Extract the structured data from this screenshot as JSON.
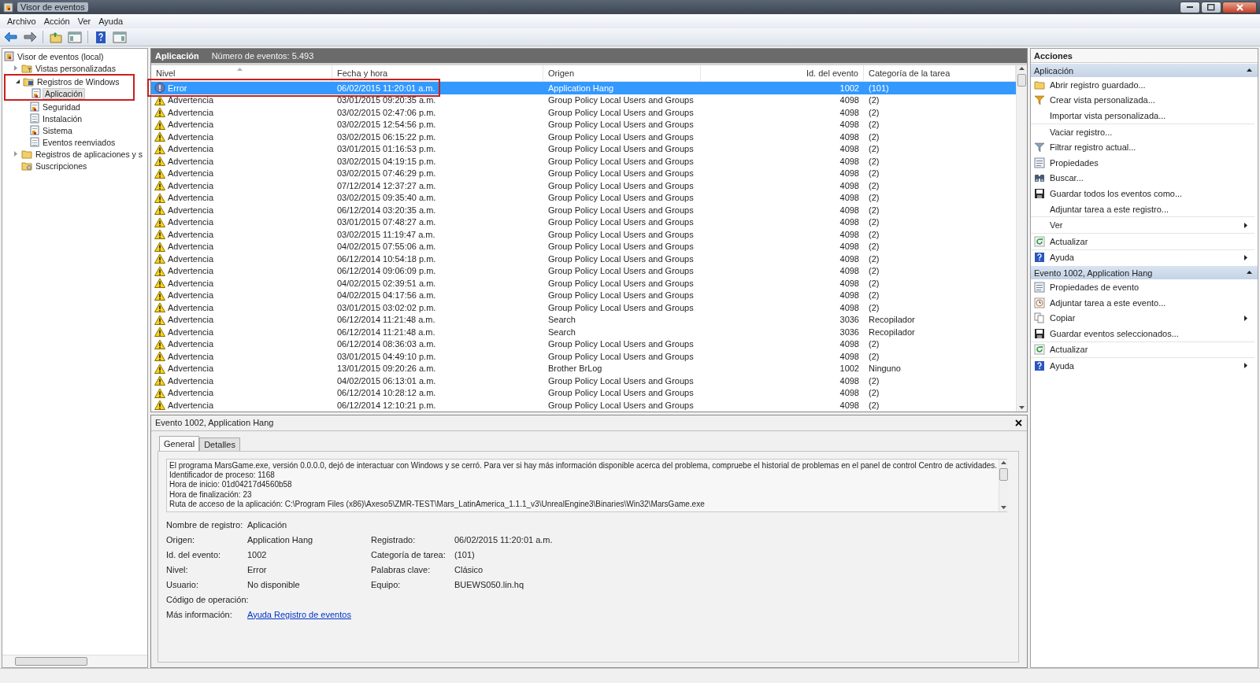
{
  "window": {
    "title": "Visor de eventos"
  },
  "menu": [
    "Archivo",
    "Acción",
    "Ver",
    "Ayuda"
  ],
  "tree": [
    {
      "label": "Visor de eventos (local)",
      "kind": "viewer",
      "selected": false,
      "children": [
        {
          "label": "Vistas personalizadas",
          "kind": "folder-filter",
          "selected": false,
          "expandable": true,
          "expanded": false
        },
        {
          "label": "Registros de Windows",
          "kind": "folder-windows",
          "selected": false,
          "expandable": true,
          "expanded": true,
          "marked": true,
          "children": [
            {
              "label": "Aplicación",
              "kind": "log",
              "selected": true,
              "marked": true
            },
            {
              "label": "Seguridad",
              "kind": "log",
              "selected": false
            },
            {
              "label": "Instalación",
              "kind": "log-plain",
              "selected": false
            },
            {
              "label": "Sistema",
              "kind": "log",
              "selected": false
            },
            {
              "label": "Eventos reenviados",
              "kind": "log-plain",
              "selected": false
            }
          ]
        },
        {
          "label": "Registros de aplicaciones y s",
          "kind": "folder",
          "selected": false,
          "expandable": true,
          "expanded": false
        },
        {
          "label": "Suscripciones",
          "kind": "folder-subs",
          "selected": false
        }
      ]
    }
  ],
  "list_header": {
    "title": "Aplicación",
    "count": "Número de eventos: 5.493"
  },
  "table": {
    "columns": [
      "Nivel",
      "Fecha y hora",
      "Origen",
      "Id. del evento",
      "Categoría de la tarea"
    ],
    "rows": [
      {
        "kind": "error",
        "level": "Error",
        "date": "06/02/2015 11:20:01 a.m.",
        "source": "Application Hang",
        "id": "1002",
        "category": "(101)",
        "selected": true,
        "marked": true
      },
      {
        "kind": "warning",
        "level": "Advertencia",
        "date": "03/01/2015 09:20:35 a.m.",
        "source": "Group Policy Local Users and Groups",
        "id": "4098",
        "category": "(2)",
        "selected": false
      },
      {
        "kind": "warning",
        "level": "Advertencia",
        "date": "03/02/2015 02:47:06 p.m.",
        "source": "Group Policy Local Users and Groups",
        "id": "4098",
        "category": "(2)",
        "selected": false
      },
      {
        "kind": "warning",
        "level": "Advertencia",
        "date": "03/02/2015 12:54:56 p.m.",
        "source": "Group Policy Local Users and Groups",
        "id": "4098",
        "category": "(2)",
        "selected": false
      },
      {
        "kind": "warning",
        "level": "Advertencia",
        "date": "03/02/2015 06:15:22 p.m.",
        "source": "Group Policy Local Users and Groups",
        "id": "4098",
        "category": "(2)",
        "selected": false
      },
      {
        "kind": "warning",
        "level": "Advertencia",
        "date": "03/01/2015 01:16:53 p.m.",
        "source": "Group Policy Local Users and Groups",
        "id": "4098",
        "category": "(2)",
        "selected": false
      },
      {
        "kind": "warning",
        "level": "Advertencia",
        "date": "03/02/2015 04:19:15 p.m.",
        "source": "Group Policy Local Users and Groups",
        "id": "4098",
        "category": "(2)",
        "selected": false
      },
      {
        "kind": "warning",
        "level": "Advertencia",
        "date": "03/02/2015 07:46:29 p.m.",
        "source": "Group Policy Local Users and Groups",
        "id": "4098",
        "category": "(2)",
        "selected": false
      },
      {
        "kind": "warning",
        "level": "Advertencia",
        "date": "07/12/2014 12:37:27 a.m.",
        "source": "Group Policy Local Users and Groups",
        "id": "4098",
        "category": "(2)",
        "selected": false
      },
      {
        "kind": "warning",
        "level": "Advertencia",
        "date": "03/02/2015 09:35:40 a.m.",
        "source": "Group Policy Local Users and Groups",
        "id": "4098",
        "category": "(2)",
        "selected": false
      },
      {
        "kind": "warning",
        "level": "Advertencia",
        "date": "06/12/2014 03:20:35 a.m.",
        "source": "Group Policy Local Users and Groups",
        "id": "4098",
        "category": "(2)",
        "selected": false
      },
      {
        "kind": "warning",
        "level": "Advertencia",
        "date": "03/01/2015 07:48:27 a.m.",
        "source": "Group Policy Local Users and Groups",
        "id": "4098",
        "category": "(2)",
        "selected": false
      },
      {
        "kind": "warning",
        "level": "Advertencia",
        "date": "03/02/2015 11:19:47 a.m.",
        "source": "Group Policy Local Users and Groups",
        "id": "4098",
        "category": "(2)",
        "selected": false
      },
      {
        "kind": "warning",
        "level": "Advertencia",
        "date": "04/02/2015 07:55:06 a.m.",
        "source": "Group Policy Local Users and Groups",
        "id": "4098",
        "category": "(2)",
        "selected": false
      },
      {
        "kind": "warning",
        "level": "Advertencia",
        "date": "06/12/2014 10:54:18 p.m.",
        "source": "Group Policy Local Users and Groups",
        "id": "4098",
        "category": "(2)",
        "selected": false
      },
      {
        "kind": "warning",
        "level": "Advertencia",
        "date": "06/12/2014 09:06:09 p.m.",
        "source": "Group Policy Local Users and Groups",
        "id": "4098",
        "category": "(2)",
        "selected": false
      },
      {
        "kind": "warning",
        "level": "Advertencia",
        "date": "04/02/2015 02:39:51 a.m.",
        "source": "Group Policy Local Users and Groups",
        "id": "4098",
        "category": "(2)",
        "selected": false
      },
      {
        "kind": "warning",
        "level": "Advertencia",
        "date": "04/02/2015 04:17:56 a.m.",
        "source": "Group Policy Local Users and Groups",
        "id": "4098",
        "category": "(2)",
        "selected": false
      },
      {
        "kind": "warning",
        "level": "Advertencia",
        "date": "03/01/2015 03:02:02 p.m.",
        "source": "Group Policy Local Users and Groups",
        "id": "4098",
        "category": "(2)",
        "selected": false
      },
      {
        "kind": "warning",
        "level": "Advertencia",
        "date": "06/12/2014 11:21:48 a.m.",
        "source": "Search",
        "id": "3036",
        "category": "Recopilador",
        "selected": false
      },
      {
        "kind": "warning",
        "level": "Advertencia",
        "date": "06/12/2014 11:21:48 a.m.",
        "source": "Search",
        "id": "3036",
        "category": "Recopilador",
        "selected": false
      },
      {
        "kind": "warning",
        "level": "Advertencia",
        "date": "06/12/2014 08:36:03 a.m.",
        "source": "Group Policy Local Users and Groups",
        "id": "4098",
        "category": "(2)",
        "selected": false
      },
      {
        "kind": "warning",
        "level": "Advertencia",
        "date": "03/01/2015 04:49:10 p.m.",
        "source": "Group Policy Local Users and Groups",
        "id": "4098",
        "category": "(2)",
        "selected": false
      },
      {
        "kind": "warning",
        "level": "Advertencia",
        "date": "13/01/2015 09:20:26 a.m.",
        "source": "Brother BrLog",
        "id": "1002",
        "category": "Ninguno",
        "selected": false
      },
      {
        "kind": "warning",
        "level": "Advertencia",
        "date": "04/02/2015 06:13:01 a.m.",
        "source": "Group Policy Local Users and Groups",
        "id": "4098",
        "category": "(2)",
        "selected": false
      },
      {
        "kind": "warning",
        "level": "Advertencia",
        "date": "06/12/2014 10:28:12 a.m.",
        "source": "Group Policy Local Users and Groups",
        "id": "4098",
        "category": "(2)",
        "selected": false
      },
      {
        "kind": "warning",
        "level": "Advertencia",
        "date": "06/12/2014 12:10:21 p.m.",
        "source": "Group Policy Local Users and Groups",
        "id": "4098",
        "category": "(2)",
        "selected": false
      }
    ]
  },
  "detail": {
    "title": "Evento 1002, Application Hang",
    "tabs": [
      {
        "label": "General",
        "selected": true
      },
      {
        "label": "Detalles",
        "selected": false
      }
    ],
    "description": [
      "El programa MarsGame.exe, versión 0.0.0.0, dejó de interactuar con Windows y se cerró. Para ver si hay más información disponible acerca del problema, compruebe el historial de problemas en el panel de control Centro de actividades.",
      "Identificador de proceso: 1168",
      "Hora de inicio: 01d04217d4560b58",
      "Hora de finalización: 23",
      "Ruta de acceso de la aplicación: C:\\Program Files (x86)\\Axeso5\\ZMR-TEST\\Mars_LatinAmerica_1.1.1_v3\\UnrealEngine3\\Binaries\\Win32\\MarsGame.exe"
    ],
    "fields": [
      {
        "left": {
          "label": "Nombre de registro:",
          "value": "Aplicación"
        }
      },
      {
        "left": {
          "label": "Origen:",
          "value": "Application Hang"
        },
        "right": {
          "label": "Registrado:",
          "value": "06/02/2015 11:20:01 a.m."
        }
      },
      {
        "left": {
          "label": "Id. del evento:",
          "value": "1002"
        },
        "right": {
          "label": "Categoría de tarea:",
          "value": "(101)"
        }
      },
      {
        "left": {
          "label": "Nivel:",
          "value": "Error"
        },
        "right": {
          "label": "Palabras clave:",
          "value": "Clásico"
        }
      },
      {
        "left": {
          "label": "Usuario:",
          "value": "No disponible"
        },
        "right": {
          "label": "Equipo:",
          "value": "BUEWS050.lin.hq"
        }
      },
      {
        "left": {
          "label": "Código de operación:"
        }
      },
      {
        "left": {
          "label": "Más información:",
          "value": "Ayuda Registro de eventos",
          "kind": "link"
        }
      }
    ]
  },
  "actions": {
    "title": "Acciones",
    "sections": [
      {
        "title": "Aplicación",
        "expanded": true,
        "items": [
          {
            "label": "Abrir registro guardado...",
            "kind": "folder"
          },
          {
            "label": "Crear vista personalizada...",
            "kind": "funnel-color"
          },
          {
            "label": "Importar vista personalizada..."
          },
          {
            "label": "Vaciar registro...",
            "divider": true
          },
          {
            "label": "Filtrar registro actual...",
            "kind": "funnel"
          },
          {
            "label": "Propiedades",
            "kind": "properties"
          },
          {
            "label": "Buscar...",
            "kind": "binoculars"
          },
          {
            "label": "Guardar todos los eventos como...",
            "kind": "save"
          },
          {
            "label": "Adjuntar tarea a este registro..."
          },
          {
            "label": "Ver",
            "divider": true,
            "submenu": true
          },
          {
            "label": "Actualizar",
            "kind": "refresh",
            "divider": true
          },
          {
            "label": "Ayuda",
            "kind": "help",
            "divider": true,
            "submenu": true
          }
        ]
      },
      {
        "title": "Evento 1002, Application Hang",
        "expanded": true,
        "items": [
          {
            "label": "Propiedades de evento",
            "kind": "properties"
          },
          {
            "label": "Adjuntar tarea a este evento...",
            "kind": "task"
          },
          {
            "label": "Copiar",
            "kind": "copy",
            "submenu": true
          },
          {
            "label": "Guardar eventos seleccionados...",
            "kind": "save"
          },
          {
            "label": "Actualizar",
            "kind": "refresh",
            "divider": true
          },
          {
            "label": "Ayuda",
            "kind": "help",
            "divider": true,
            "submenu": true
          }
        ]
      }
    ]
  }
}
